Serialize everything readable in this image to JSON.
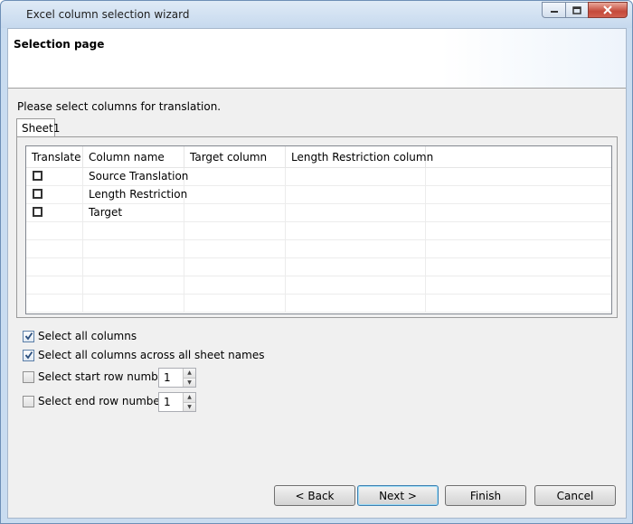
{
  "window": {
    "title": "Excel column selection wizard",
    "icons": [
      "minimize-icon",
      "maximize-icon",
      "close-icon"
    ]
  },
  "header": {
    "title": "Selection page"
  },
  "instruction": "Please select columns for translation.",
  "tabs": [
    {
      "label": "Sheet1",
      "selected": true
    }
  ],
  "table": {
    "columns": [
      "Translate",
      "Column name",
      "Target column",
      "Length Restriction column"
    ],
    "rows": [
      {
        "translate": false,
        "column_name": "Source Translation",
        "target": "",
        "length": ""
      },
      {
        "translate": false,
        "column_name": "Length Restriction",
        "target": "",
        "length": ""
      },
      {
        "translate": false,
        "column_name": "Target",
        "target": "",
        "length": ""
      }
    ]
  },
  "options": {
    "select_all": {
      "label": "Select all columns",
      "checked": true
    },
    "select_all_sheets": {
      "label": "Select all columns across all sheet names",
      "checked": true
    },
    "start_row": {
      "label": "Select start row number",
      "checked": false,
      "value": "1"
    },
    "end_row": {
      "label": "Select end row number",
      "checked": false,
      "value": "1"
    }
  },
  "buttons": {
    "back": "< Back",
    "next": "Next >",
    "finish": "Finish",
    "cancel": "Cancel"
  },
  "colors": {
    "frame": "#c9dcf0",
    "close_button": "#c4493a",
    "default_button_border": "#3c7fb1"
  }
}
